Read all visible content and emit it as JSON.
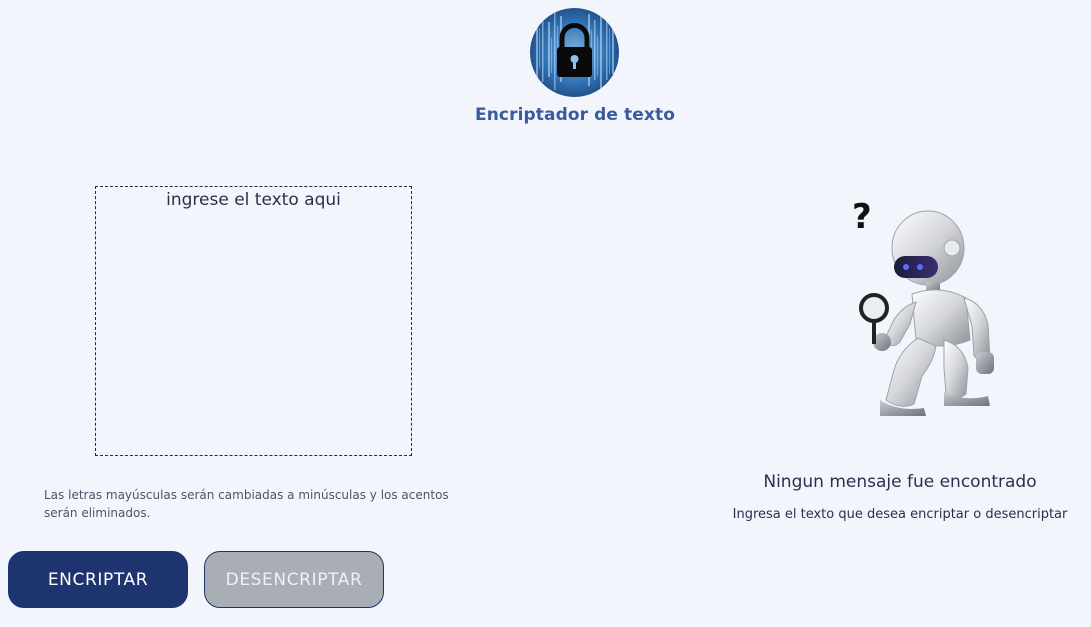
{
  "header": {
    "title": "Encriptador de texto",
    "logo_icon": "padlock-matrix-icon"
  },
  "input": {
    "placeholder": "ingrese el texto aqui",
    "value": ""
  },
  "hint": "Las letras mayúsculas serán cambiadas a minúsculas y los acentos serán eliminados.",
  "buttons": {
    "encrypt_label": "ENCRIPTAR",
    "decrypt_label": "DESENCRIPTAR"
  },
  "output": {
    "illustration_icon": "robot-magnifier-icon",
    "title": "Ningun mensaje fue encontrado",
    "subtitle": "Ingresa el texto que desea encriptar o desencriptar"
  },
  "colors": {
    "background": "#f3f5fc",
    "primary": "#1e3470",
    "title": "#3a5a9e",
    "secondary_button": "#a9adb4",
    "text": "#26324d"
  }
}
